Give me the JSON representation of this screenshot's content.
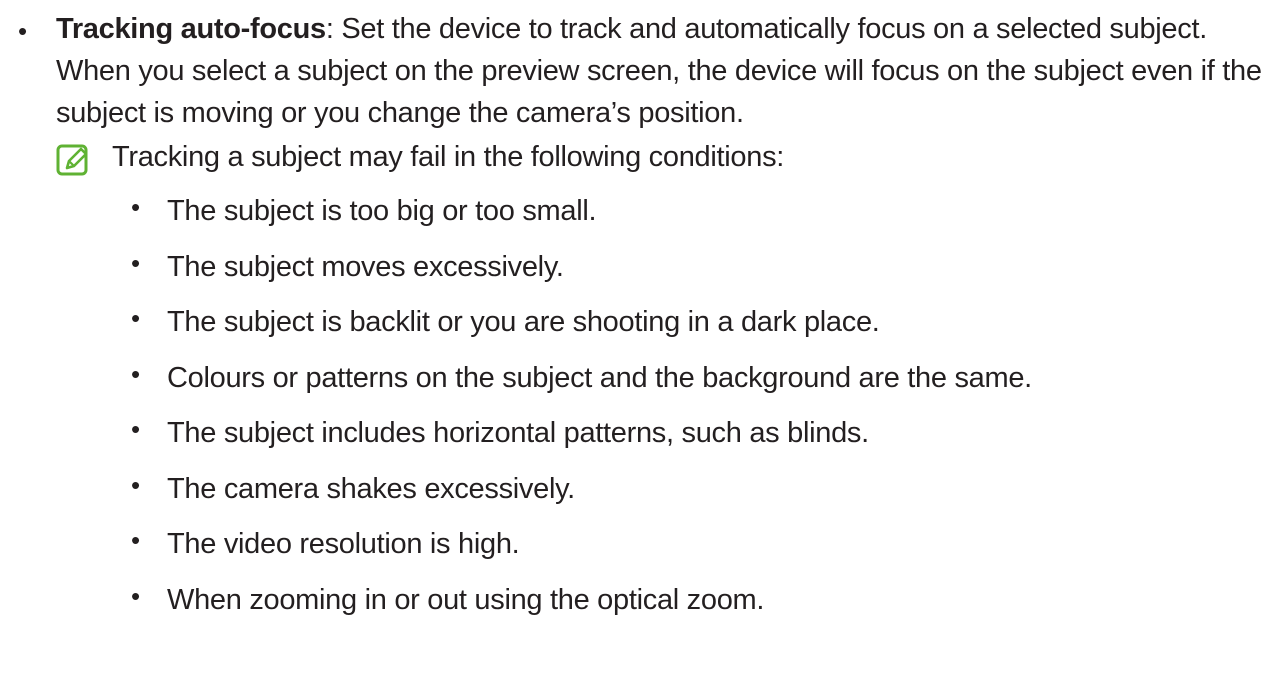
{
  "main_item": {
    "bullet": "•",
    "term": "Tracking auto-focus",
    "description": ": Set the device to track and automatically focus on a selected subject. When you select a subject on the preview screen, the device will focus on the subject even if the subject is moving or you change the camera’s position."
  },
  "note": {
    "icon": "note-pencil-icon",
    "icon_color": "#5fb233",
    "intro": "Tracking a subject may fail in the following conditions:",
    "items": [
      "The subject is too big or too small.",
      "The subject moves excessively.",
      "The subject is backlit or you are shooting in a dark place.",
      "Colours or patterns on the subject and the background are the same.",
      "The subject includes horizontal patterns, such as blinds.",
      "The camera shakes excessively.",
      "The video resolution is high.",
      "When zooming in or out using the optical zoom."
    ],
    "sub_bullet": "•"
  }
}
